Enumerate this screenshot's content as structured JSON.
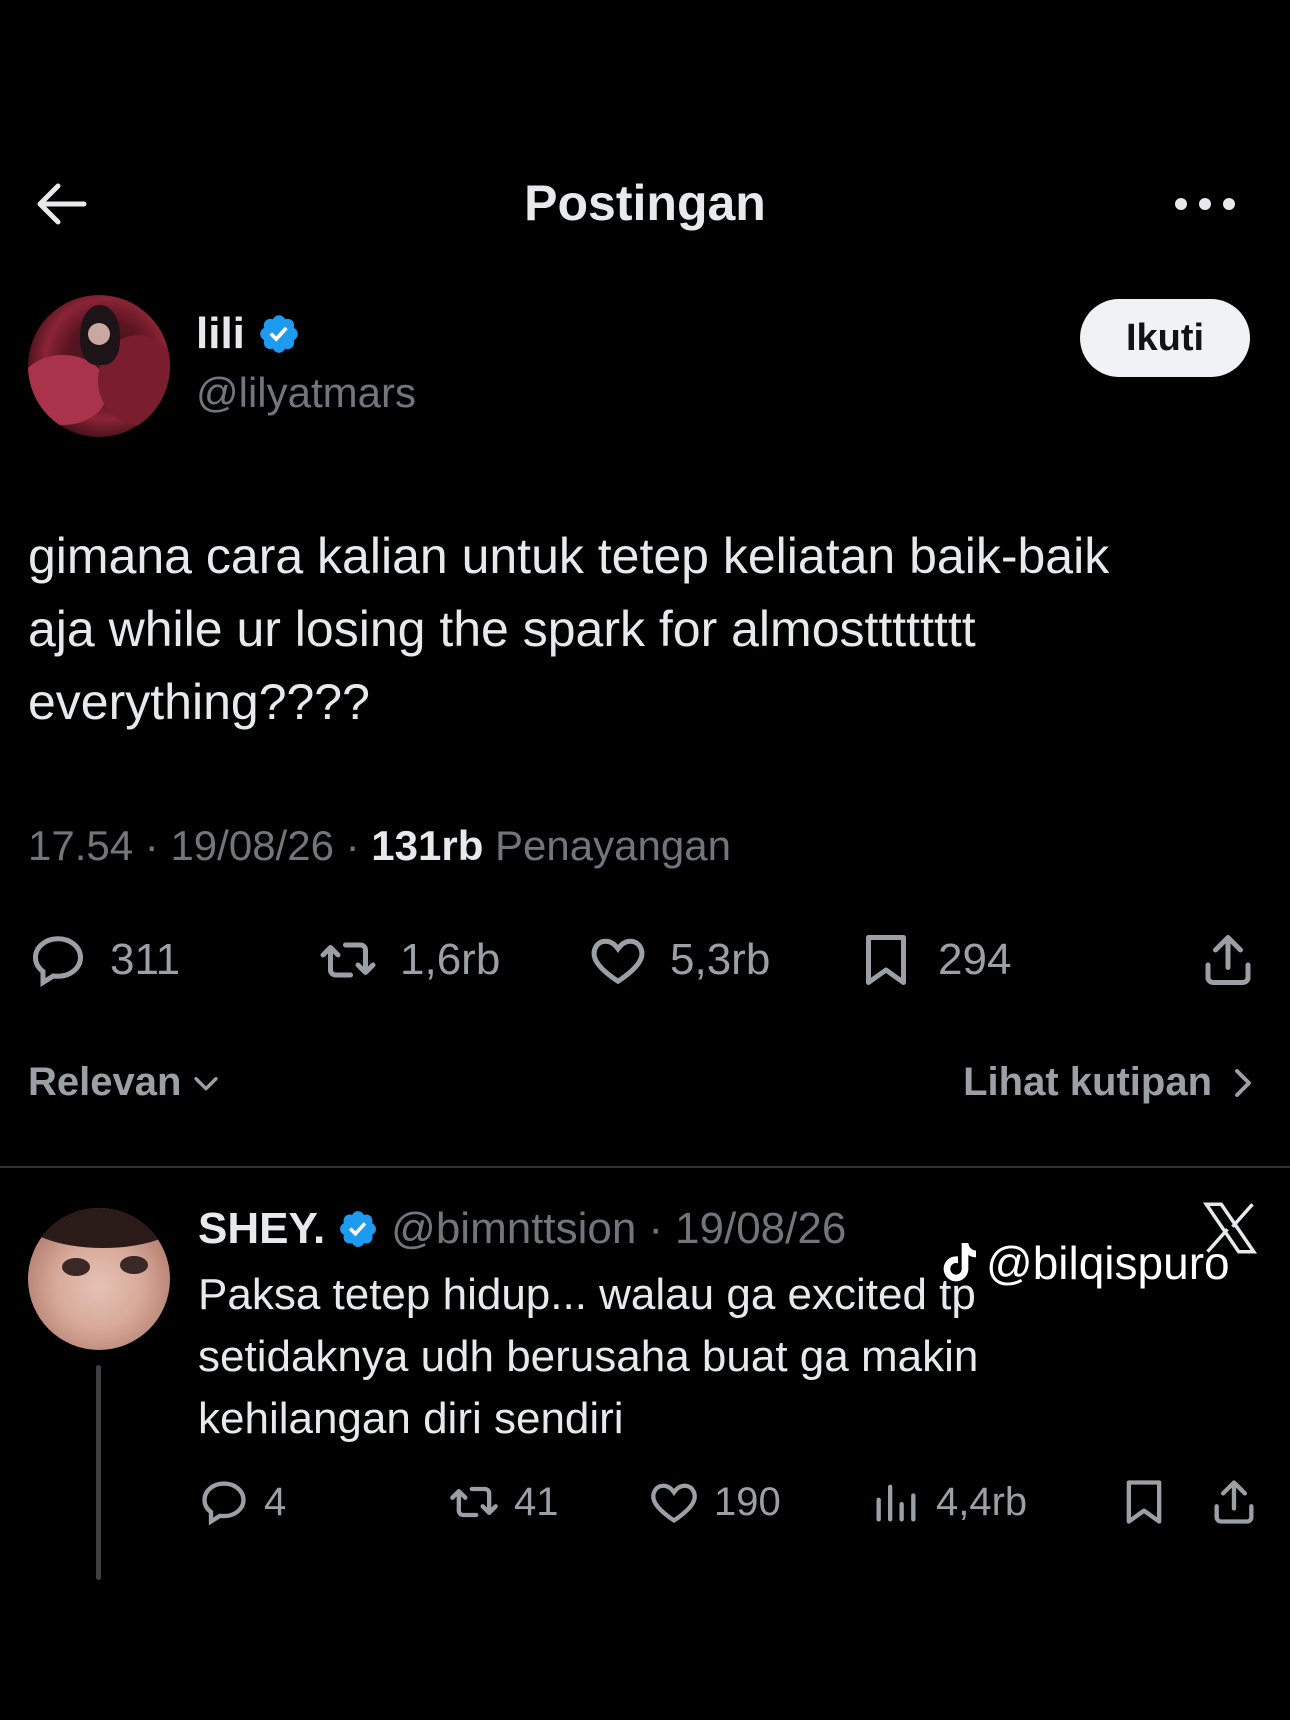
{
  "header": {
    "title": "Postingan"
  },
  "author": {
    "name": "lili",
    "handle": "@lilyatmars",
    "follow_label": "Ikuti"
  },
  "post": {
    "text": "gimana cara kalian untuk tetep keliatan baik-baik\naja while ur losing the spark for almostttttttt\neverything????",
    "time": "17.54",
    "date": "19/08/26",
    "views_count": "131rb",
    "views_label": "Penayangan",
    "separator": "·"
  },
  "stats": {
    "replies": "311",
    "reposts": "1,6rb",
    "likes": "5,3rb",
    "bookmarks": "294"
  },
  "sort": {
    "left_label": "Relevan",
    "right_label": "Lihat kutipan"
  },
  "reply": {
    "name": "SHEY.",
    "handle": "@bimnttsion",
    "date": "19/08/26",
    "separator": "·",
    "text": "Paksa tetep hidup... walau ga excited tp\nsetidaknya udh berusaha buat ga makin\nkehilangan diri sendiri",
    "stats": {
      "replies": "4",
      "reposts": "41",
      "likes": "190",
      "views": "4,4rb"
    }
  },
  "watermark": {
    "text": "@bilqispuro"
  },
  "colors": {
    "background": "#000000",
    "text": "#e7e9ea",
    "muted": "#71767b",
    "verified": "#1d9bf0",
    "follow_bg": "#eff3f4"
  }
}
